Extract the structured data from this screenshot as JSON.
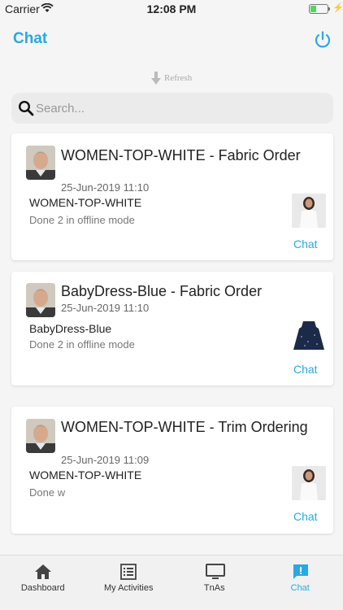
{
  "status_bar": {
    "carrier": "Carrier",
    "time": "12:08 PM"
  },
  "header": {
    "title": "Chat"
  },
  "refresh": {
    "label": "Refresh"
  },
  "search": {
    "placeholder": "Search..."
  },
  "chats": [
    {
      "title": "WOMEN-TOP-WHITE - Fabric Order",
      "date": "25-Jun-2019 11:10",
      "item": "WOMEN-TOP-WHITE",
      "message": "Done 2 in offline mode",
      "action": "Chat"
    },
    {
      "title": "BabyDress-Blue - Fabric Order",
      "date": "25-Jun-2019 11:10",
      "item": "BabyDress-Blue",
      "message": "Done 2 in offline mode",
      "action": "Chat"
    },
    {
      "title": "WOMEN-TOP-WHITE - Trim Ordering",
      "date": "25-Jun-2019 11:09",
      "item": "WOMEN-TOP-WHITE",
      "message": "Done w",
      "action": "Chat"
    }
  ],
  "tabs": [
    {
      "label": "Dashboard",
      "icon": "home-icon"
    },
    {
      "label": "My Activities",
      "icon": "list-icon"
    },
    {
      "label": "TnAs",
      "icon": "monitor-icon"
    },
    {
      "label": "Chat",
      "icon": "chat-alert-icon",
      "active": true
    }
  ],
  "colors": {
    "accent": "#29a9e1",
    "battery": "#4cd964"
  }
}
